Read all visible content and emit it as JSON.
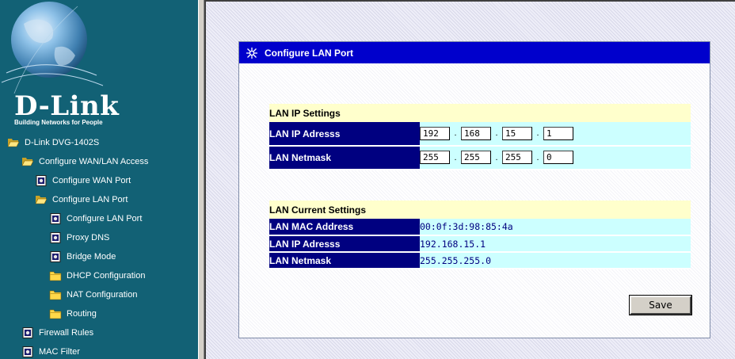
{
  "sidebar": {
    "logo": "D-Link",
    "tagline": "Building Networks for People",
    "items": [
      {
        "label": "D-Link DVG-1402S",
        "icon": "folder-open-icon"
      },
      {
        "label": "Configure WAN/LAN Access",
        "icon": "folder-open-icon"
      },
      {
        "label": "Configure WAN Port",
        "icon": "page-icon"
      },
      {
        "label": "Configure LAN Port",
        "icon": "folder-open-icon"
      },
      {
        "label": "Configure LAN Port",
        "icon": "page-icon"
      },
      {
        "label": "Proxy DNS",
        "icon": "page-icon"
      },
      {
        "label": "Bridge Mode",
        "icon": "page-icon"
      },
      {
        "label": "DHCP Configuration",
        "icon": "folder-closed-icon"
      },
      {
        "label": "NAT Configuration",
        "icon": "folder-closed-icon"
      },
      {
        "label": "Routing",
        "icon": "folder-closed-icon"
      },
      {
        "label": "Firewall Rules",
        "icon": "page-icon"
      },
      {
        "label": "MAC Filter",
        "icon": "page-icon"
      }
    ]
  },
  "panel": {
    "title": "Configure LAN Port",
    "ip_settings": {
      "heading": "LAN IP Settings",
      "ip_label": "LAN IP Adresss",
      "ip_octets": [
        "192",
        "168",
        "15",
        "1"
      ],
      "netmask_label": "LAN Netmask",
      "netmask_octets": [
        "255",
        "255",
        "255",
        "0"
      ]
    },
    "current_settings": {
      "heading": "LAN Current Settings",
      "mac_label": "LAN MAC Address",
      "mac_value": "00:0f:3d:98:85:4a",
      "ip_label": "LAN IP Adresss",
      "ip_value": "192.168.15.1",
      "netmask_label": "LAN Netmask",
      "netmask_value": "255.255.255.0"
    },
    "save_label": "Save"
  },
  "colors": {
    "sidebar_bg": "#126175",
    "header_bg": "#0000cc",
    "label_bg": "#000080",
    "section_bg": "#ffffcc",
    "value_bg": "#ccffff"
  }
}
